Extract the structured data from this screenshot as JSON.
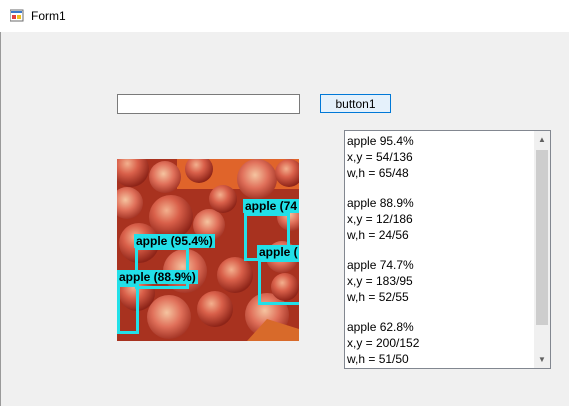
{
  "window": {
    "title": "Form1",
    "icon": "form-app-icon"
  },
  "textbox": {
    "value": ""
  },
  "button": {
    "label": "button1"
  },
  "image": {
    "detections": [
      {
        "label": "apple (95.4%)"
      },
      {
        "label": "apple (88.9%)"
      },
      {
        "label": "apple (74"
      },
      {
        "label": "apple ("
      }
    ]
  },
  "results": [
    {
      "name": "apple 95.4%",
      "xy": "x,y = 54/136",
      "wh": "w,h = 65/48"
    },
    {
      "name": "apple 88.9%",
      "xy": "x,y = 12/186",
      "wh": "w,h = 24/56"
    },
    {
      "name": "apple 74.7%",
      "xy": "x,y = 183/95",
      "wh": "w,h = 52/55"
    },
    {
      "name": "apple 62.8%",
      "xy": "x,y = 200/152",
      "wh": "w,h = 51/50"
    }
  ],
  "colors": {
    "detection": "#22e0e8",
    "button_border": "#0078d7"
  }
}
